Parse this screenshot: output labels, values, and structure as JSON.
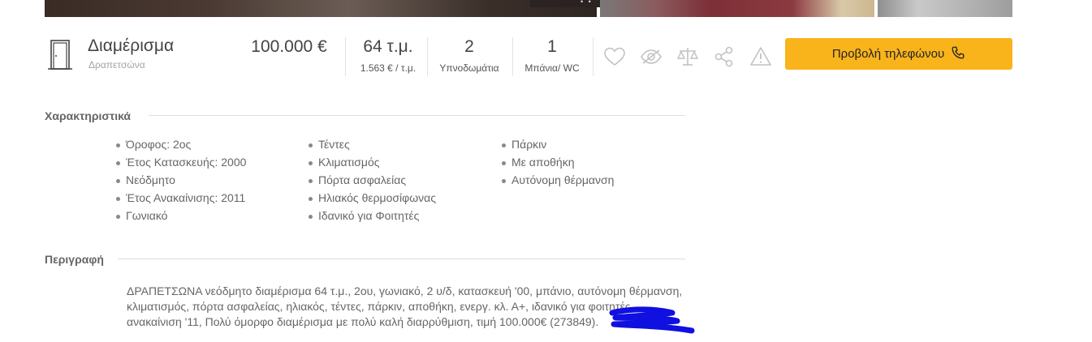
{
  "property": {
    "type_label": "Διαμέρισμα",
    "location": "Δραπετσώνα",
    "price": "100.000 €",
    "area": "64 τ.μ.",
    "price_per_sqm": "1.563 € / τ.μ.",
    "bedrooms_value": "2",
    "bedrooms_label": "Υπνοδωμάτια",
    "baths_value": "1",
    "baths_label": "Μπάνια/ WC"
  },
  "actions": {
    "phone_button_label": "Προβολή τηλεφώνου",
    "icons": [
      "heart-icon",
      "hide-icon",
      "compare-scale-icon",
      "share-icon",
      "report-warning-icon"
    ]
  },
  "features": {
    "title": "Χαρακτηριστικά",
    "col1": [
      "Όροφος: 2ος",
      "Έτος Κατασκευής: 2000",
      "Νεόδμητο",
      "Έτος Ανακαίνισης: 2011",
      "Γωνιακό"
    ],
    "col2": [
      "Τέντες",
      "Κλιματισμός",
      "Πόρτα ασφαλείας",
      "Ηλιακός θερμοσίφωνας",
      "Ιδανικό για Φοιτητές"
    ],
    "col3": [
      "Πάρκιν",
      "Με αποθήκη",
      "Αυτόνομη θέρμανση"
    ]
  },
  "description": {
    "title": "Περιγραφή",
    "line1": "ΔΡΑΠΕΤΣΩΝΑ νεόδμητο διαμέρισμα 64 τ.μ., 2ου, γωνιακό, 2 υ/δ, κατασκευή '00, μπάνιο, αυτόνομη θέρμανση,",
    "line2": "κλιματισμός, πόρτα ασφαλείας, ηλιακός, τέντες, πάρκιν, αποθήκη, ενεργ. κλ. Α+, ιδανικό για φοιτητές,",
    "line3": "ανακαίνιση '11, Πολύ όμορφο διαμέρισμα με πολύ καλή διαρρύθμιση, τιμή 100.000€ (273849)."
  },
  "colors": {
    "accent": "#f9b31b",
    "redaction": "#1010e0"
  }
}
